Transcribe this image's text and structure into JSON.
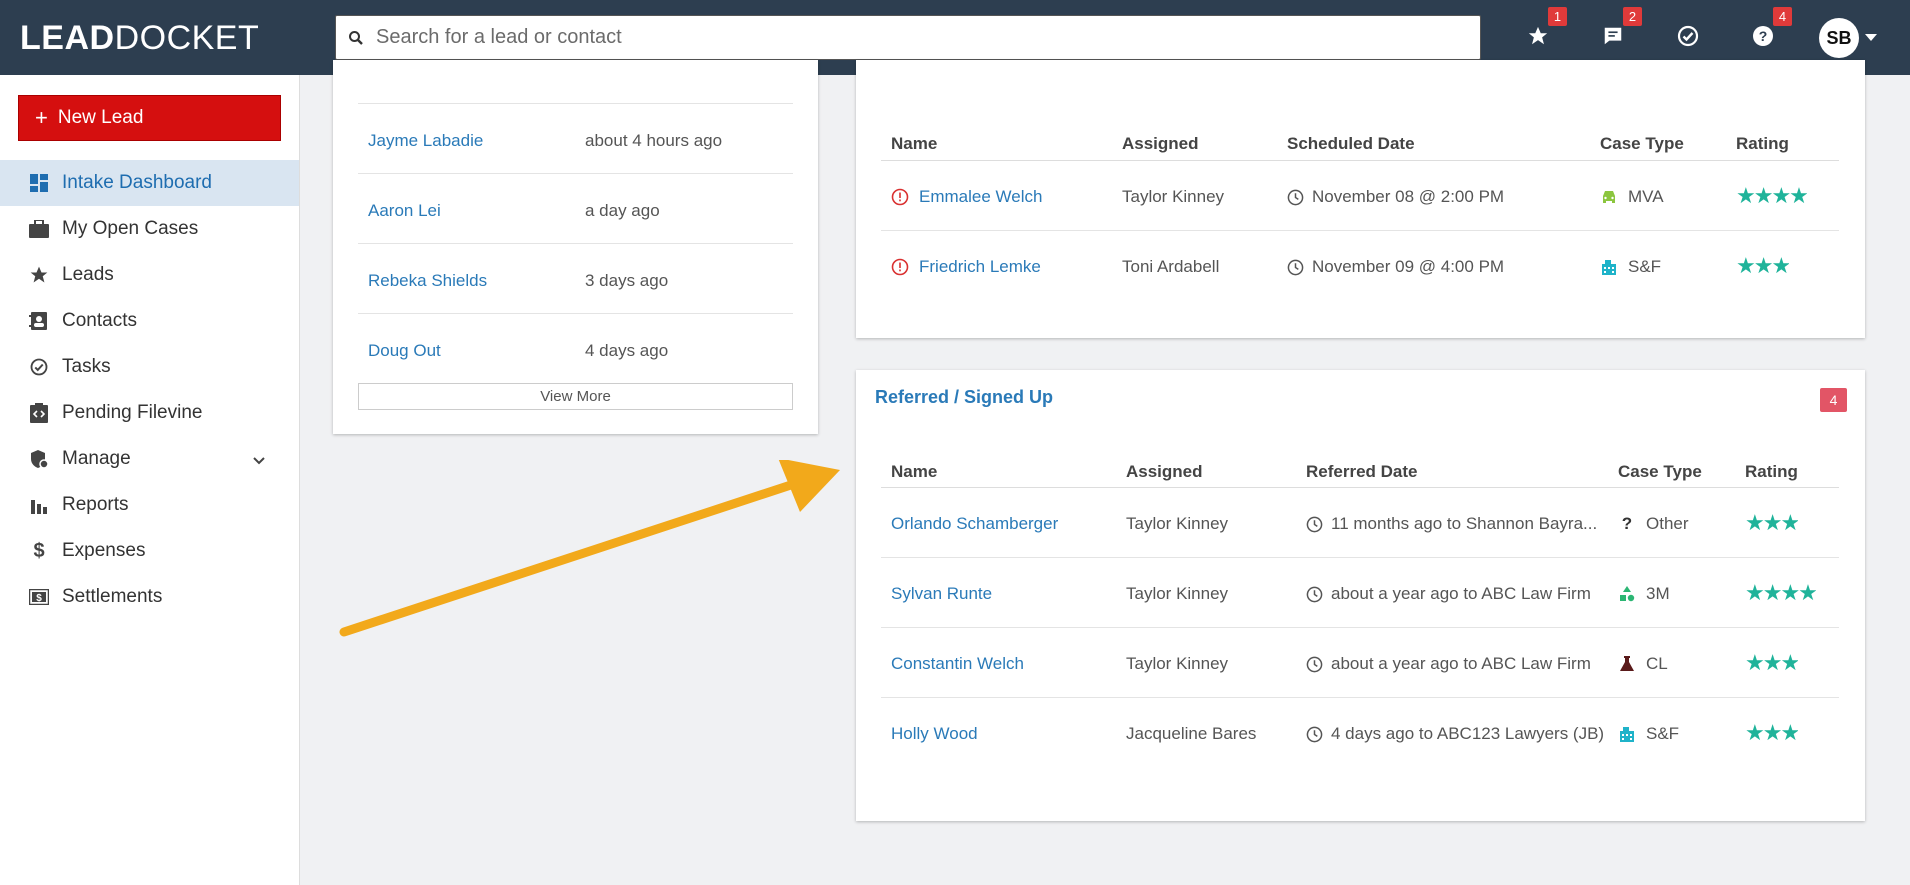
{
  "app": {
    "logo_bold": "LEAD",
    "logo_light": "DOCKET",
    "search_placeholder": "Search for a lead or contact",
    "badges": {
      "favorites": "1",
      "messages": "2",
      "help": "4"
    },
    "user_initials": "SB"
  },
  "sidebar": {
    "new_lead": "New Lead",
    "items": [
      {
        "label": "Intake Dashboard",
        "icon": "dashboard-icon",
        "active": true
      },
      {
        "label": "My Open Cases",
        "icon": "briefcase-icon"
      },
      {
        "label": "Leads",
        "icon": "star-icon"
      },
      {
        "label": "Contacts",
        "icon": "contacts-icon"
      },
      {
        "label": "Tasks",
        "icon": "check-circle-icon"
      },
      {
        "label": "Pending Filevine",
        "icon": "code-clipboard-icon"
      },
      {
        "label": "Manage",
        "icon": "shield-gear-icon"
      },
      {
        "label": "Reports",
        "icon": "bar-chart-icon"
      },
      {
        "label": "Expenses",
        "icon": "dollar-icon"
      },
      {
        "label": "Settlements",
        "icon": "money-icon"
      }
    ]
  },
  "recent": {
    "rows": [
      {
        "name": "Jayme Labadie",
        "time": "about 4 hours ago"
      },
      {
        "name": "Aaron Lei",
        "time": "a day ago"
      },
      {
        "name": "Rebeka Shields",
        "time": "3 days ago"
      },
      {
        "name": "Doug Out",
        "time": "4 days ago"
      }
    ],
    "view_more": "View More"
  },
  "scheduled": {
    "headers": {
      "name": "Name",
      "assigned": "Assigned",
      "date": "Scheduled Date",
      "case_type": "Case Type",
      "rating": "Rating"
    },
    "rows": [
      {
        "name": "Emmalee Welch",
        "assigned": "Taylor Kinney",
        "date": "November 08 @ 2:00 PM",
        "case_type": "MVA",
        "rating": "★★★★"
      },
      {
        "name": "Friedrich Lemke",
        "assigned": "Toni Ardabell",
        "date": "November 09 @ 4:00 PM",
        "case_type": "S&F",
        "rating": "★★★"
      }
    ]
  },
  "referred": {
    "title": "Referred / Signed Up",
    "count": "4",
    "headers": {
      "name": "Name",
      "assigned": "Assigned",
      "date": "Referred Date",
      "case_type": "Case Type",
      "rating": "Rating"
    },
    "rows": [
      {
        "name": "Orlando Schamberger",
        "assigned": "Taylor Kinney",
        "date": "11 months ago to Shannon Bayra...",
        "case_type": "Other",
        "rating": "★★★"
      },
      {
        "name": "Sylvan Runte",
        "assigned": "Taylor Kinney",
        "date": "about a year ago to ABC Law Firm",
        "case_type": "3M",
        "rating": "★★★★"
      },
      {
        "name": "Constantin Welch",
        "assigned": "Taylor Kinney",
        "date": "about a year ago to ABC Law Firm",
        "case_type": "CL",
        "rating": "★★★"
      },
      {
        "name": "Holly Wood",
        "assigned": "Jacqueline Bares",
        "date": "4 days ago to ABC123 Lawyers (JB)",
        "case_type": "S&F",
        "rating": "★★★"
      }
    ]
  },
  "colors": {
    "topbar": "#2d3e50",
    "accent": "#2a7ab8",
    "new_lead": "#d50f0f",
    "star": "#1fb39a",
    "arrow": "#f2a91b"
  }
}
